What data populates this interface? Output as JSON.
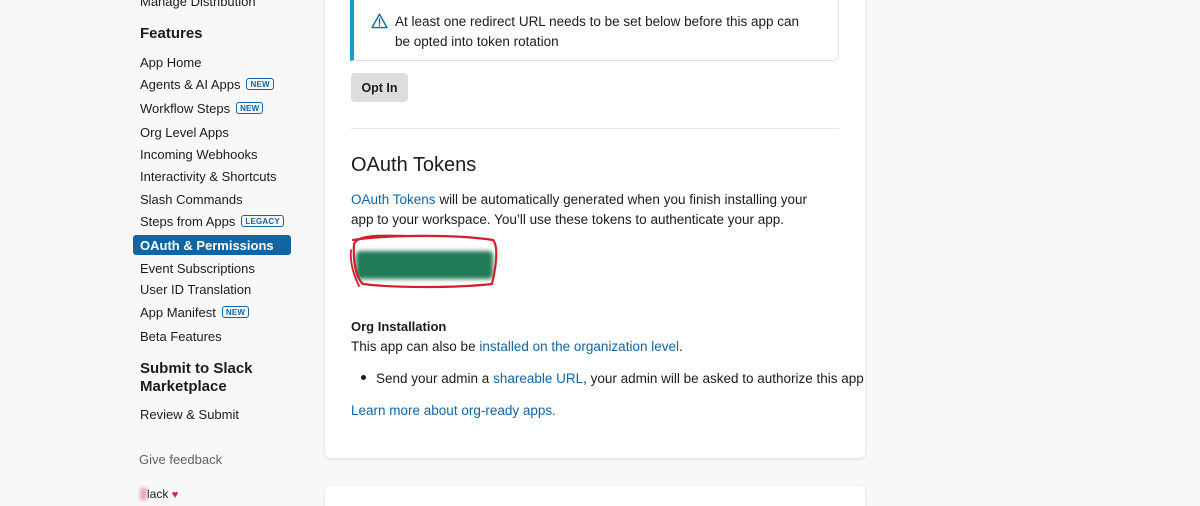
{
  "sidebar": {
    "top_item": "Manage Distribution",
    "features_heading": "Features",
    "items": [
      {
        "label": "App Home",
        "badge": ""
      },
      {
        "label": "Agents & AI Apps",
        "badge": "NEW"
      },
      {
        "label": "Workflow Steps",
        "badge": "NEW"
      },
      {
        "label": "Org Level Apps",
        "badge": ""
      },
      {
        "label": "Incoming Webhooks",
        "badge": ""
      },
      {
        "label": "Interactivity & Shortcuts",
        "badge": ""
      },
      {
        "label": "Slash Commands",
        "badge": ""
      },
      {
        "label": "Steps from Apps",
        "badge": "LEGACY"
      },
      {
        "label": "OAuth & Permissions",
        "badge": "",
        "active": true
      },
      {
        "label": "Event Subscriptions",
        "badge": ""
      },
      {
        "label": "User ID Translation",
        "badge": ""
      },
      {
        "label": "App Manifest",
        "badge": "NEW"
      },
      {
        "label": "Beta Features",
        "badge": ""
      }
    ],
    "submit_heading": "Submit to Slack Marketplace",
    "review_submit": "Review & Submit",
    "give_feedback": "Give feedback",
    "footer_text": "lack"
  },
  "alert": {
    "icon": "warning-icon",
    "text": "At least one redirect URL needs to be set below before this app can be opted into token rotation"
  },
  "opt_in_label": "Opt In",
  "oauth": {
    "title": "OAuth Tokens",
    "link_text": "OAuth Tokens",
    "desc_rest": " will be automatically generated when you finish installing your app to your workspace. You’ll use these tokens to authenticate your app."
  },
  "org": {
    "title": "Org Installation",
    "desc_before": "This app can also be ",
    "desc_link": "installed on the organization level",
    "desc_after": ".",
    "bullet_before": "Send your admin a ",
    "bullet_link": "shareable URL",
    "bullet_after": ", your admin will be asked to authorize this app",
    "learn_more": "Learn more about org-ready apps."
  },
  "colors": {
    "accent": "#1264a3",
    "alert_border": "#1d9bd1",
    "install_button": "#1f7a55",
    "scribble": "#d0202e",
    "heart": "#e01e5a"
  }
}
